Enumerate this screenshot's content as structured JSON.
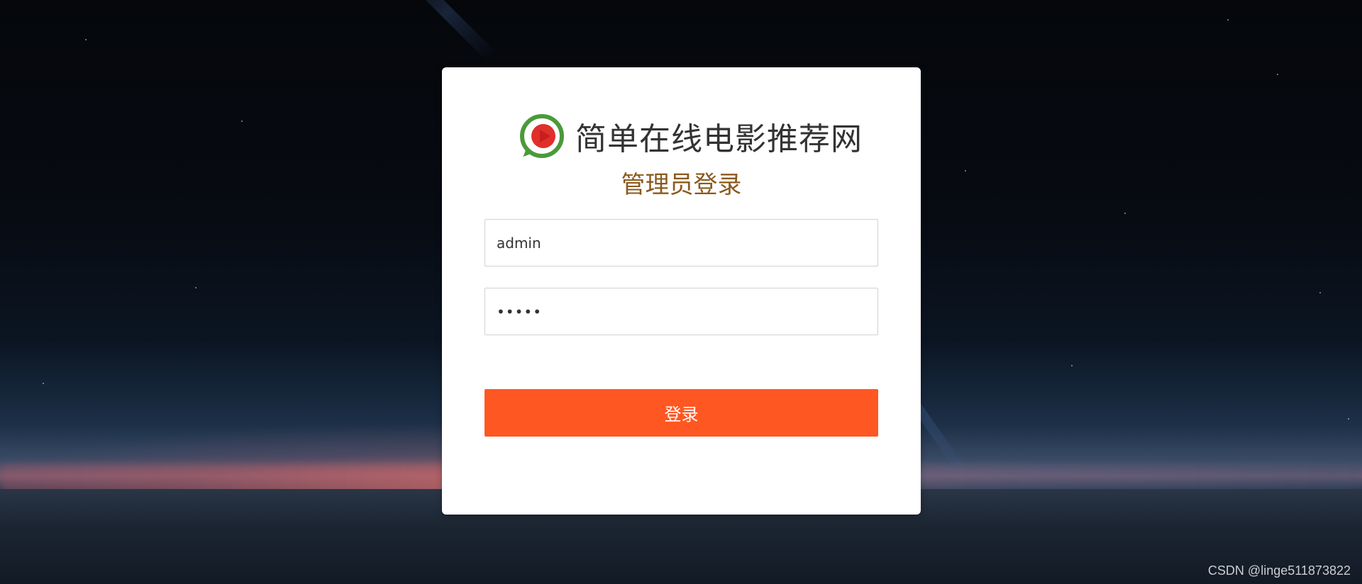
{
  "site": {
    "title": "简单在线电影推荐网",
    "logo_icon": "play-logo-icon"
  },
  "login": {
    "heading": "管理员登录",
    "username": {
      "value": "admin"
    },
    "password": {
      "value": "admin"
    },
    "submit_label": "登录"
  },
  "watermark": "CSDN @linge511873822",
  "colors": {
    "button": "#ff5722",
    "heading": "#8a5a1e",
    "logo_green": "#4a9a3a",
    "logo_red": "#e0302a"
  }
}
